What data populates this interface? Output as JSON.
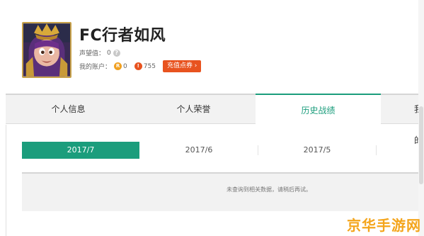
{
  "profile": {
    "username": "FC行者如风",
    "reputation_label": "声望值：",
    "reputation_value": "0",
    "account_label": "我的账户：",
    "coin_gold_glyph": "R",
    "coin_gold_value": "0",
    "coin_red_glyph": "!",
    "coin_red_value": "755",
    "recharge_label": "充值点券 ›",
    "help_glyph": "?"
  },
  "tabs": [
    {
      "label": "个人信息",
      "active": false
    },
    {
      "label": "个人荣誉",
      "active": false
    },
    {
      "label": "历史战绩",
      "active": true
    },
    {
      "label": "我的",
      "active": false
    }
  ],
  "months": [
    {
      "label": "2017/7",
      "active": true
    },
    {
      "label": "2017/6",
      "active": false
    },
    {
      "label": "2017/5",
      "active": false
    }
  ],
  "results": {
    "empty_message": "未查询到相关数据，请稍后再试。"
  },
  "watermark": "京华手游网",
  "colors": {
    "accent": "#1b9d7c",
    "recharge": "#e8531f",
    "gold_coin": "#f0a020"
  }
}
